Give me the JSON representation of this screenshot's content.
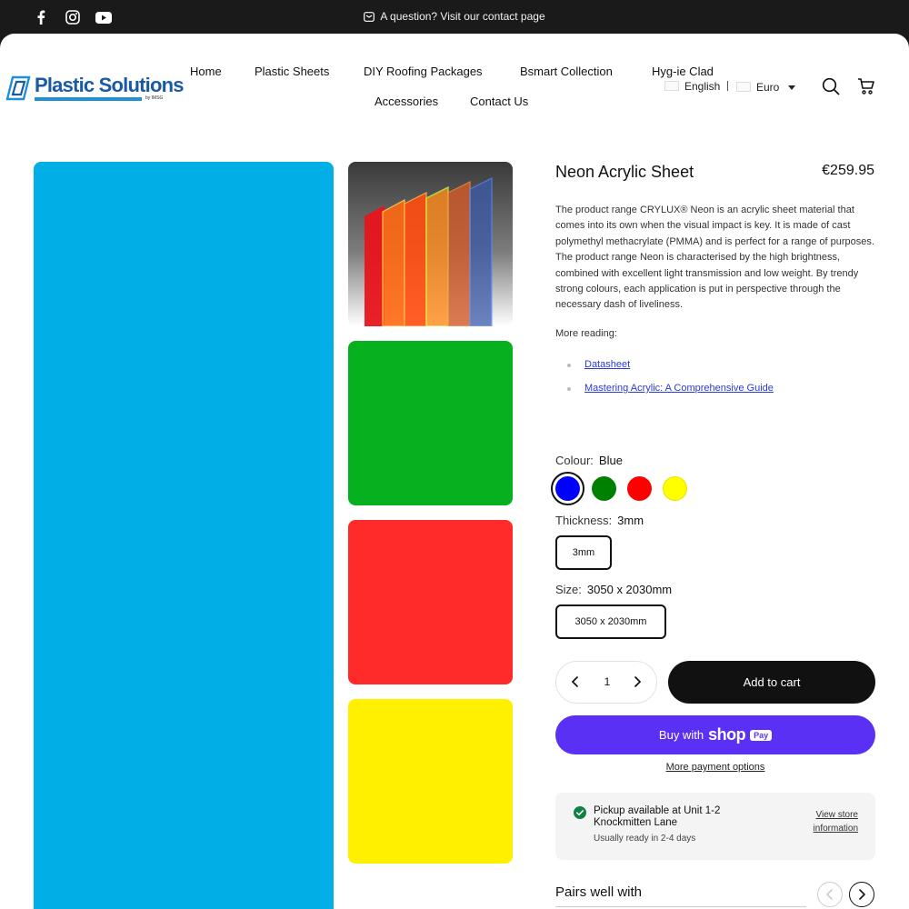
{
  "topbar": {
    "social_icons": [
      "facebook-icon",
      "instagram-icon",
      "youtube-icon"
    ],
    "announcement": "A question? Visit our contact page"
  },
  "header": {
    "logo_text": "Plastic Solutions",
    "logo_sub": "by IMSG",
    "nav": [
      "Home",
      "Plastic Sheets",
      "DIY Roofing Packages",
      "Bsmart Collection",
      "Hyg-ie Clad",
      "Accessories",
      "Contact Us"
    ],
    "language": "English",
    "currency": "Euro",
    "icons": [
      "search-icon",
      "cart-icon"
    ]
  },
  "gallery": {
    "main_color": "#01aee6",
    "thumb_colors": [
      "#06b01f",
      "#ff2a2a",
      "#fff000"
    ]
  },
  "product": {
    "title": "Neon Acrylic Sheet",
    "price": "€259.95",
    "description": "The product range CRYLUX® Neon is an acrylic sheet material that comes into its own when the visual impact is key. It is made of cast polymethyl methacrylate (PMMA) and is perfect for a range of purposes. The product range Neon is characterised by the high brightness, combined with excellent light transmission and low weight. By trendy strong colours, each application is put in perspective through the necessary dash of liveliness.",
    "more_reading": "More reading:",
    "links": [
      "Datasheet",
      "Mastering Acrylic: A Comprehensive Guide"
    ],
    "colour_label": "Colour:",
    "colour_value": "Blue",
    "swatches": [
      "#0000ff",
      "#008000",
      "#ff0000",
      "#ffff00"
    ],
    "thickness_label": "Thickness:",
    "thickness_value": "3mm",
    "thickness_option": "3mm",
    "size_label": "Size:",
    "size_value": "3050 x 2030mm",
    "size_option": "3050 x 2030mm",
    "quantity": "1",
    "add_to_cart": "Add to cart",
    "buy_with": "Buy with",
    "shop_word": "shop",
    "pay_word": "Pay",
    "more_payment": "More payment options",
    "pickup_title": "Pickup available at Unit 1-2 Knockmitten Lane",
    "pickup_sub": "Usually ready in 2-4 days",
    "view_store": "View store information",
    "pairs_title": "Pairs well with"
  }
}
